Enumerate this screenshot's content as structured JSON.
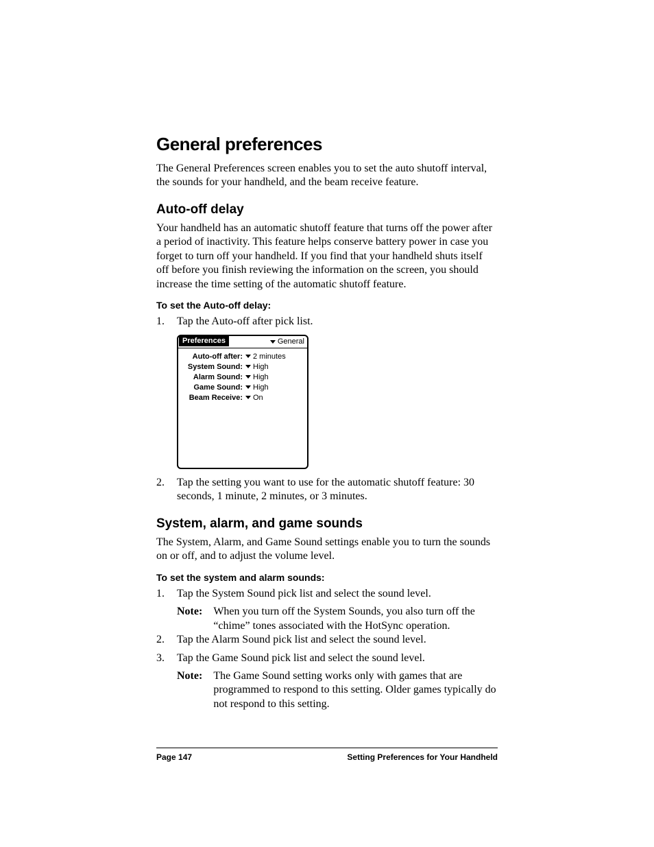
{
  "h1": "General preferences",
  "intro": "The General Preferences screen enables you to set the auto shutoff interval, the sounds for your handheld, and the beam receive feature.",
  "auto_off": {
    "title": "Auto-off delay",
    "para": "Your handheld has an automatic shutoff feature that turns off the power after a period of inactivity. This feature helps conserve battery power in case you forget to turn off your handheld. If you find that your handheld shuts itself off before you finish reviewing the information on the screen, you should increase the time setting of the automatic shutoff feature.",
    "subhead": "To set the Auto-off delay:",
    "steps": [
      "Tap the Auto-off after pick list.",
      "Tap the setting you want to use for the automatic shutoff feature: 30 seconds, 1 minute, 2 minutes, or 3 minutes."
    ]
  },
  "screenshot": {
    "title_left": "Preferences",
    "title_right": "General",
    "rows": [
      {
        "label": "Auto-off after:",
        "value": "2 minutes"
      },
      {
        "label": "System Sound:",
        "value": "High"
      },
      {
        "label": "Alarm Sound:",
        "value": "High"
      },
      {
        "label": "Game Sound:",
        "value": "High"
      },
      {
        "label": "Beam Receive:",
        "value": "On"
      }
    ]
  },
  "sounds": {
    "title": "System, alarm, and game sounds",
    "para": "The System, Alarm, and Game Sound settings enable you to turn the sounds on or off, and to adjust the volume level.",
    "subhead": "To set the system and alarm sounds:",
    "steps": [
      "Tap the System Sound pick list and select the sound level.",
      "Tap the Alarm Sound pick list and select the sound level.",
      "Tap the Game Sound pick list and select the sound level."
    ],
    "notes": [
      {
        "after_step": 1,
        "label": "Note:",
        "text": "When you turn off the System Sounds, you also turn off the “chime” tones associated with the HotSync operation."
      },
      {
        "after_step": 3,
        "label": "Note:",
        "text": "The Game Sound setting works only with games that are programmed to respond to this setting. Older games typically do not respond to this setting."
      }
    ]
  },
  "footer": {
    "left": "Page 147",
    "right": "Setting Preferences for Your Handheld"
  }
}
